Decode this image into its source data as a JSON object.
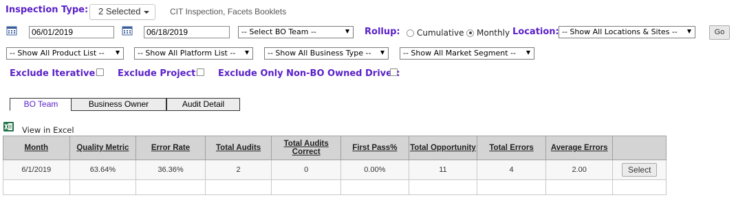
{
  "filters": {
    "inspection_type_label": "Inspection Type:",
    "inspection_selected": "2 Selected",
    "inspection_summary": "CIT Inspection, Facets Booklets",
    "start_date": "06/01/2019",
    "end_date": "06/18/2019",
    "bo_team": "-- Select BO Team --",
    "rollup_label": "Rollup:",
    "rollup_options": [
      "Cumulative",
      "Monthly"
    ],
    "rollup_selected": "Monthly",
    "location_label": "Location:",
    "location": "-- Show All Locations & Sites --",
    "go_label": "Go",
    "product_list": "-- Show All Product List --",
    "platform_list": "-- Show All Platform List --",
    "business_type": "-- Show All Business Type --",
    "market_segment": "-- Show All Market Segment --",
    "exclude_iterative_label": "Exclude Iterative:",
    "exclude_project_label": "Exclude Project:",
    "exclude_non_bo_label": "Exclude Only Non-BO Owned Driver:"
  },
  "tabs": [
    "BO Team",
    "Business Owner",
    "Audit Detail"
  ],
  "active_tab": "BO Team",
  "excel_label": "View in Excel",
  "table": {
    "headers": [
      "Month",
      "Quality Metric",
      "Error Rate",
      "Total Audits",
      "Total Audits Correct",
      "First Pass%",
      "Total Opportunity",
      "Total Errors",
      "Average Errors",
      ""
    ],
    "rows": [
      [
        "6/1/2019",
        "63.64%",
        "36.36%",
        "2",
        "0",
        "0.00%",
        "11",
        "4",
        "2.00",
        "Select"
      ]
    ]
  },
  "colors": {
    "label_purple": "#5a20c8",
    "header_gray": "#d4d4d4",
    "excel_green": "#1e7145"
  }
}
